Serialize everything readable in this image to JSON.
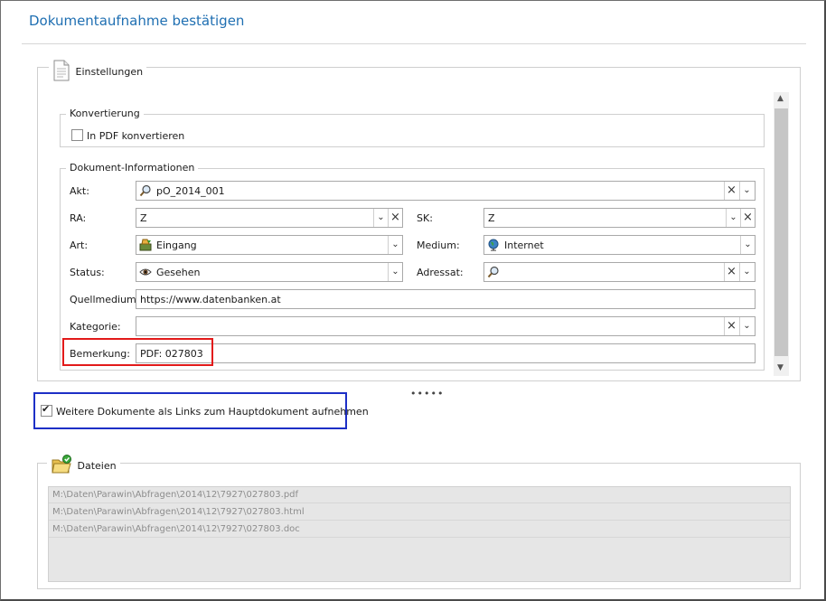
{
  "dialog": {
    "title": "Dokumentaufnahme bestätigen"
  },
  "einstellungen": {
    "legend": "Einstellungen",
    "konvertierung": {
      "legend": "Konvertierung",
      "pdf_checkbox_label": "In PDF konvertieren",
      "pdf_checked": false
    },
    "dokument_info": {
      "legend": "Dokument-Informationen",
      "akt": {
        "label": "Akt:",
        "value": "pO_2014_001"
      },
      "ra": {
        "label": "RA:",
        "value": "Z"
      },
      "sk": {
        "label": "SK:",
        "value": "Z"
      },
      "art": {
        "label": "Art:",
        "value": "Eingang"
      },
      "medium": {
        "label": "Medium:",
        "value": "Internet"
      },
      "status": {
        "label": "Status:",
        "value": "Gesehen"
      },
      "adressat": {
        "label": "Adressat:",
        "value": ""
      },
      "quellmedium": {
        "label": "Quellmedium:",
        "value": "https://www.datenbanken.at"
      },
      "kategorie": {
        "label": "Kategorie:",
        "value": ""
      },
      "bemerkung": {
        "label": "Bemerkung:",
        "value": "PDF: 027803"
      }
    }
  },
  "splitter": "•••••",
  "links_checkbox": {
    "label": "Weitere Dokumente als Links zum Hauptdokument aufnehmen",
    "checked": true
  },
  "dateien": {
    "legend": "Dateien",
    "files": [
      "M:\\Daten\\Parawin\\Abfragen\\2014\\12\\7927\\027803.pdf",
      "M:\\Daten\\Parawin\\Abfragen\\2014\\12\\7927\\027803.html",
      "M:\\Daten\\Parawin\\Abfragen\\2014\\12\\7927\\027803.doc"
    ]
  },
  "colors": {
    "title": "#1f6fb2",
    "highlight_red": "#e21a1a",
    "highlight_blue": "#1d2fc6"
  }
}
